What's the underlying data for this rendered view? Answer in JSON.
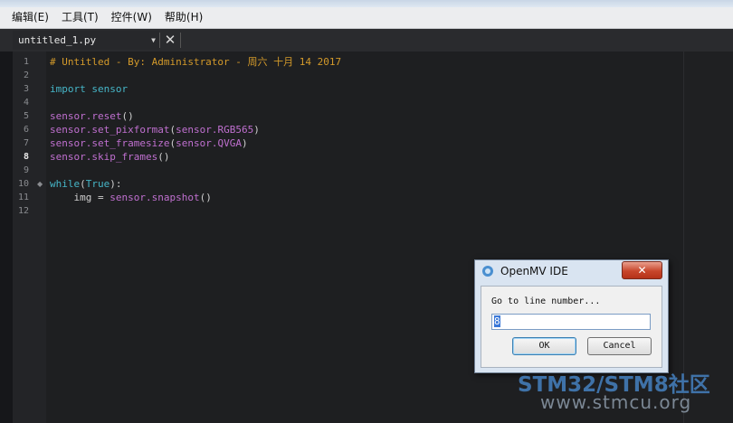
{
  "menubar": {
    "items": [
      "编辑(E)",
      "工具(T)",
      "控件(W)",
      "帮助(H)"
    ]
  },
  "tab": {
    "filename": "untitled_1.py",
    "close_icon": "close-icon",
    "dropdown_icon": "chevron-down-icon"
  },
  "gutter": {
    "lines": [
      "1",
      "2",
      "3",
      "4",
      "5",
      "6",
      "7",
      "8",
      "9",
      "10",
      "11",
      "12"
    ],
    "current_line": "8"
  },
  "code": {
    "line1": "# Untitled - By: Administrator - 周六 十月 14 2017",
    "line3_kw": "import",
    "line3_mod": "sensor",
    "line5_obj": "sensor",
    "line5_fn": ".reset",
    "line5_rest": "()",
    "line6_obj": "sensor",
    "line6_fn": ".set_pixformat",
    "line6_open": "(",
    "line6_arg": "sensor.RGB565",
    "line6_close": ")",
    "line7_obj": "sensor",
    "line7_fn": ".set_framesize",
    "line7_open": "(",
    "line7_arg": "sensor.QVGA",
    "line7_close": ")",
    "line8_obj": "sensor",
    "line8_fn": ".skip_frames",
    "line8_rest": "()",
    "line10_kw": "while",
    "line10_open": "(",
    "line10_arg": "True",
    "line10_close": "):",
    "line11_indent": "    img = ",
    "line11_obj": "sensor",
    "line11_fn": ".snapshot",
    "line11_rest": "()"
  },
  "dialog": {
    "title": "OpenMV IDE",
    "close_label": "✕",
    "label": "Go to line number...",
    "input_value": "8",
    "ok_label": "OK",
    "cancel_label": "Cancel"
  },
  "watermark": {
    "line1": "STM32/STM8社区",
    "line2": "www.stmcu.org"
  },
  "colors": {
    "comment": "#d49a2a",
    "keyword": "#46b6c8",
    "identifier": "#c070d0",
    "editor_bg": "#1e1f21"
  }
}
